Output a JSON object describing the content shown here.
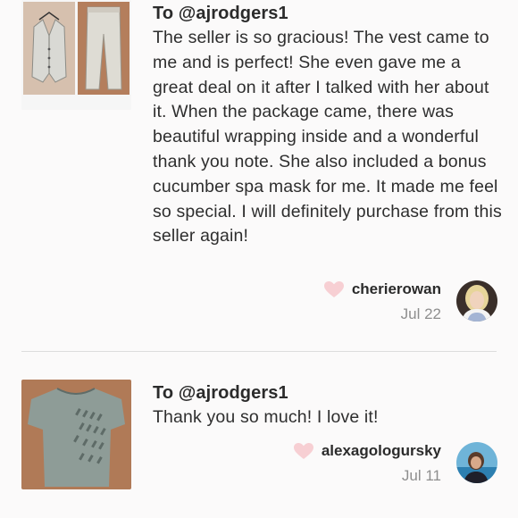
{
  "reviews": [
    {
      "to": "To @ajrodgers1",
      "text": "The seller is so gracious! The vest came to me and is perfect! She even gave me a great deal on it after I talked with her about it. When the package came, there was beautiful wrapping inside and a wonderful thank you note. She also included a bonus cucumber spa mask for me. It made me feel so special. I will definitely purchase from this seller again!",
      "username": "cherierowan",
      "date": "Jul 22",
      "thumb_icon": "vest-and-pants-photo",
      "avatar_icon": "user-avatar-photo"
    },
    {
      "to": "To @ajrodgers1",
      "text": "Thank you so much! I love it!",
      "username": "alexagologursky",
      "date": "Jul 11",
      "thumb_icon": "gray-tshirt-photo",
      "avatar_icon": "user-avatar-photo"
    }
  ],
  "colors": {
    "heart": "#f7cfd3",
    "date": "#8e8e8e",
    "divider": "#dddddd"
  }
}
